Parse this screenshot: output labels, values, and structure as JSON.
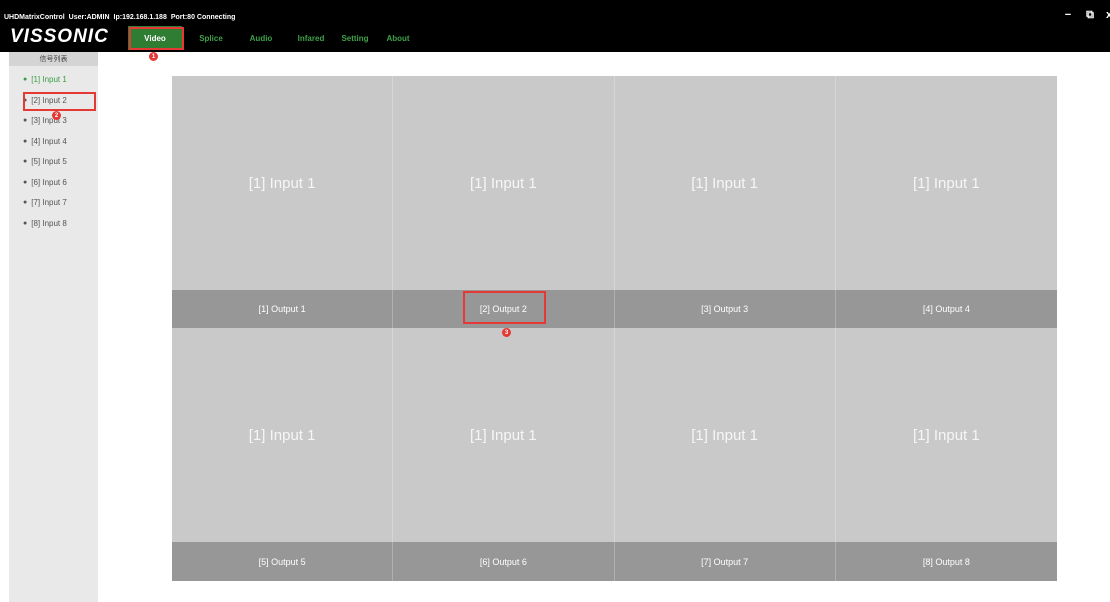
{
  "window": {
    "app_name": "UHDMatrixControl",
    "user": "User:ADMIN",
    "ip": "Ip:192.168.1.188",
    "port": "Port:80 Connecting",
    "controls": [
      "−",
      "⧉",
      "x"
    ]
  },
  "brand": {
    "logo": "VISSONIC"
  },
  "nav": {
    "tabs": [
      {
        "label": "Video",
        "active": true
      },
      {
        "label": "Splice"
      },
      {
        "label": "Audio"
      },
      {
        "label": "Infared"
      },
      {
        "label": "Setting"
      },
      {
        "label": "About"
      }
    ]
  },
  "sidebar": {
    "header": "信号列表",
    "inputs": [
      {
        "label": "[1] Input 1",
        "active": true
      },
      {
        "label": "[2] Input 2"
      },
      {
        "label": "[3] Input 3"
      },
      {
        "label": "[4] Input 4"
      },
      {
        "label": "[5] Input 5"
      },
      {
        "label": "[6] Input 6"
      },
      {
        "label": "[7] Input 7"
      },
      {
        "label": "[8] Input 8"
      }
    ]
  },
  "grid": {
    "row1": {
      "cells": [
        "[1] Input 1",
        "[1] Input 1",
        "[1] Input 1",
        "[1] Input 1"
      ],
      "outputs": [
        "[1] Output 1",
        "[2] Output 2",
        "[3] Output 3",
        "[4] Output 4"
      ]
    },
    "row2": {
      "cells": [
        "[1] Input 1",
        "[1] Input 1",
        "[1] Input 1",
        "[1] Input 1"
      ],
      "outputs": [
        "[5] Output 5",
        "[6] Output 6",
        "[7] Output 7",
        "[8] Output 8"
      ]
    }
  },
  "annotations": {
    "markers": [
      "1",
      "2",
      "3"
    ],
    "color": "#e53935"
  },
  "colors": {
    "accent": "#2e7d32",
    "active_text": "#3a9d46",
    "highlight": "#e53935"
  }
}
